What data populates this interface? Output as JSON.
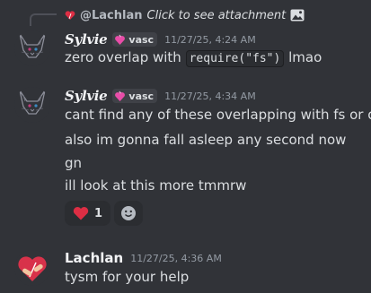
{
  "reply": {
    "name": "@Lachlan",
    "text": "Click to see attachment",
    "heart_icon": "small-heart-icon",
    "image_icon": "image-icon"
  },
  "messages": [
    {
      "author": "Sylvie",
      "tag": "vasc",
      "tag_icon": "heart-fire-icon",
      "timestamp": "11/27/25, 4:24 AM",
      "line_before": "zero overlap with",
      "code": "require(\"fs\")",
      "line_after": "lmao"
    },
    {
      "author": "Sylvie",
      "tag": "vasc",
      "tag_icon": "heart-fire-icon",
      "timestamp": "11/27/25, 4:34 AM",
      "lines": [
        "cant find any of these overlapping with fs or os",
        "also im gonna fall asleep any second now",
        "gn",
        "ill look at this more tmmrw"
      ]
    },
    {
      "author": "Lachlan",
      "timestamp": "11/27/25, 4:36 AM",
      "text": "tysm for your help"
    }
  ],
  "reactions": [
    {
      "emoji": "red-heart-icon",
      "count": "1"
    },
    {
      "emoji": "add-reaction-icon"
    }
  ],
  "colors": {
    "background": "#313338",
    "text": "#dbdee1",
    "muted": "#949ba4",
    "reaction_bg": "#2b2d31",
    "heart": "#dd2e44"
  }
}
